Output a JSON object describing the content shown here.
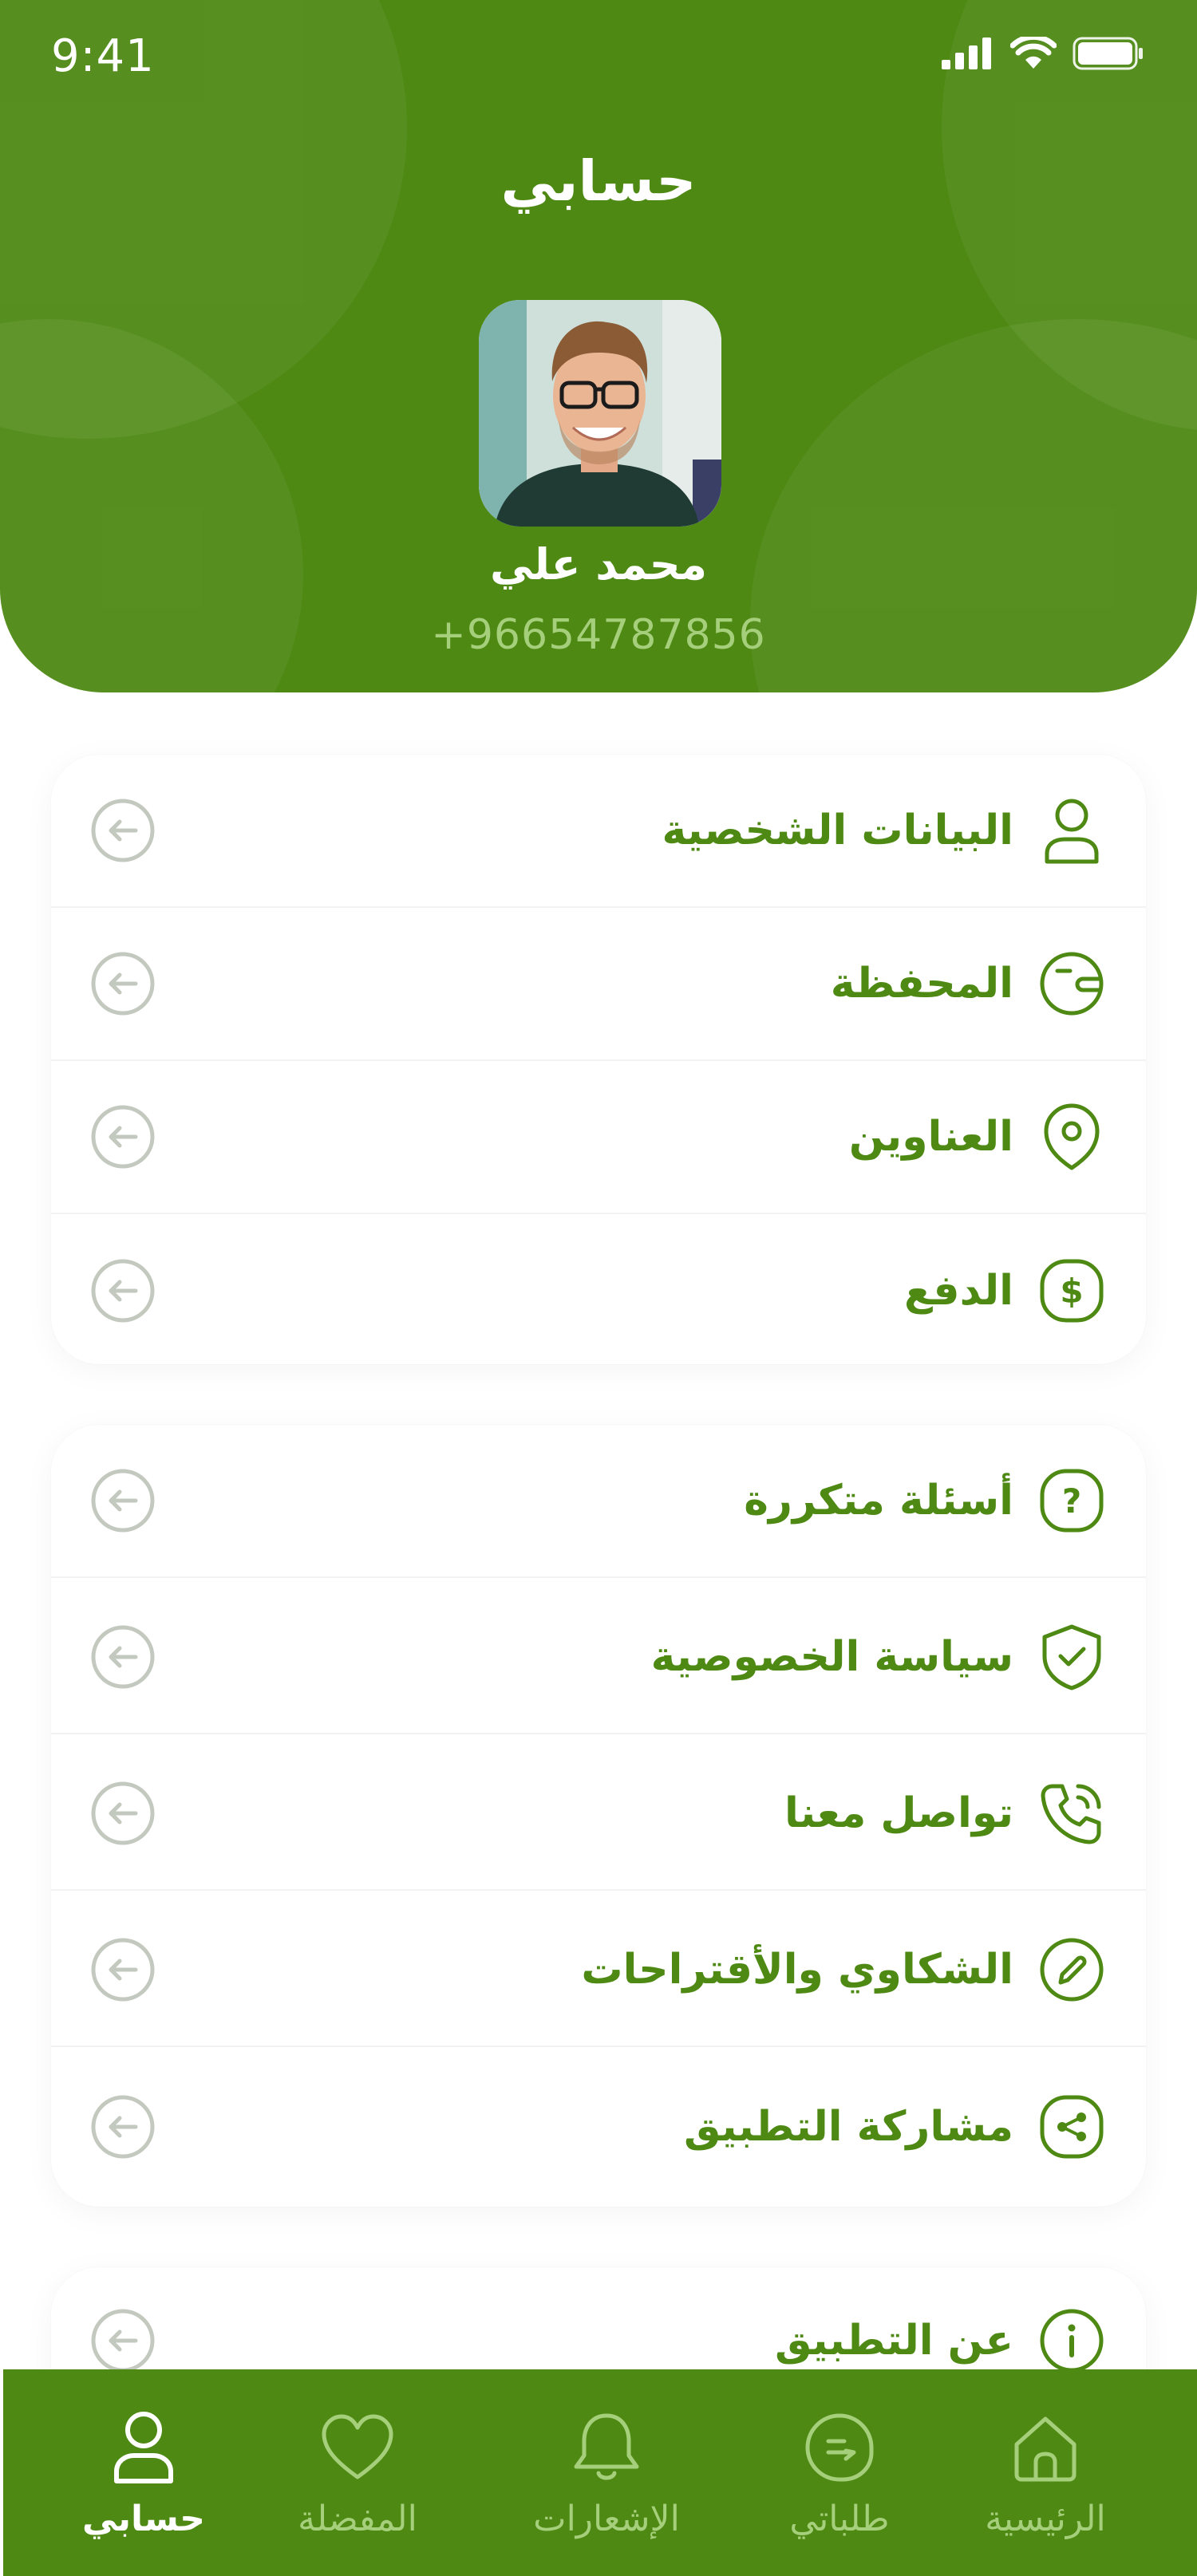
{
  "status_bar": {
    "time": "9:41"
  },
  "header": {
    "title": "حسابي",
    "user_name": "محمد علي",
    "user_phone": "+96654787856"
  },
  "menu_groups": [
    {
      "items": [
        {
          "label": "البيانات الشخصية",
          "icon": "user-icon"
        },
        {
          "label": "المحفظة",
          "icon": "wallet-icon"
        },
        {
          "label": "العناوين",
          "icon": "location-icon"
        },
        {
          "label": "الدفع",
          "icon": "dollar-icon"
        }
      ]
    },
    {
      "items": [
        {
          "label": "أسئلة متكررة",
          "icon": "question-icon"
        },
        {
          "label": "سياسة الخصوصية",
          "icon": "shield-check-icon"
        },
        {
          "label": "تواصل معنا",
          "icon": "phone-call-icon"
        },
        {
          "label": "الشكاوي والأقتراحات",
          "icon": "edit-icon"
        },
        {
          "label": "مشاركة التطبيق",
          "icon": "share-icon"
        }
      ]
    },
    {
      "items": [
        {
          "label": "عن التطبيق",
          "icon": "info-icon"
        }
      ]
    }
  ],
  "bottom_nav": [
    {
      "label": "الرئيسية",
      "icon": "home-icon",
      "active": false
    },
    {
      "label": "طلباتي",
      "icon": "orders-icon",
      "active": false
    },
    {
      "label": "الإشعارات",
      "icon": "bell-icon",
      "active": false
    },
    {
      "label": "المفضلة",
      "icon": "heart-icon",
      "active": false
    },
    {
      "label": "حسابي",
      "icon": "profile-icon",
      "active": true
    }
  ],
  "colors": {
    "brand_green": "#4d8913",
    "light_green": "#a6cf7b",
    "arrow_gray": "#c4c9bf",
    "white": "#ffffff"
  }
}
